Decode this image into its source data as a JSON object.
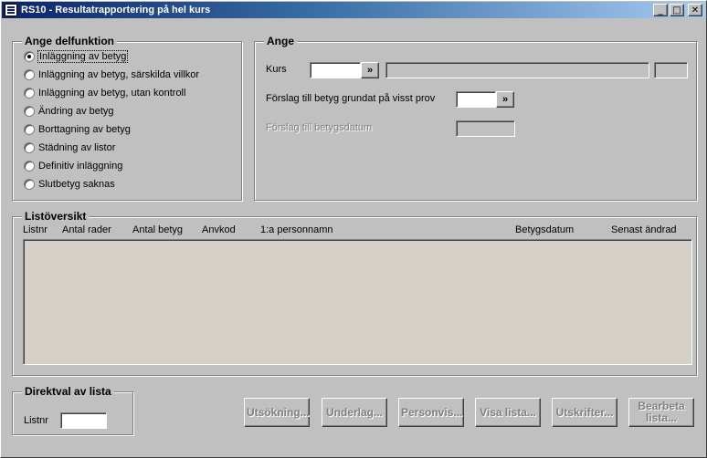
{
  "window": {
    "title": "RS10 - Resultatrapportering på hel kurs",
    "minimize": "_",
    "maximize": "□",
    "close": "✕"
  },
  "delfunktion": {
    "label": "Ange delfunktion",
    "options": [
      {
        "label": "Inläggning av betyg",
        "checked": true
      },
      {
        "label": "Inläggning av betyg, särskilda villkor",
        "checked": false
      },
      {
        "label": "Inläggning av betyg, utan kontroll",
        "checked": false
      },
      {
        "label": "Ändring av betyg",
        "checked": false
      },
      {
        "label": "Borttagning av betyg",
        "checked": false
      },
      {
        "label": "Städning av listor",
        "checked": false
      },
      {
        "label": "Definitiv inläggning",
        "checked": false
      },
      {
        "label": "Slutbetyg saknas",
        "checked": false
      }
    ]
  },
  "ange": {
    "label": "Ange",
    "kurs_label": "Kurs",
    "kurs_value": "",
    "lookup": "»",
    "forslag_prov_label": "Förslag till betyg grundat på visst prov",
    "forslag_prov_value": "",
    "forslag_datum_label": "Förslag till betygsdatum",
    "forslag_datum_value": ""
  },
  "listoversikt": {
    "label": "Listöversikt",
    "columns": [
      "Listnr",
      "Antal rader",
      "Antal betyg",
      "Anvkod",
      "1:a personnamn",
      "Betygsdatum",
      "Senast ändrad"
    ],
    "rows": []
  },
  "direktval": {
    "label": "Direktval av lista",
    "listnr_label": "Listnr",
    "listnr_value": ""
  },
  "buttons": {
    "utsokning": "Utsökning...",
    "underlag": "Underlag...",
    "personvis": "Personvis...",
    "visa_lista": "Visa lista...",
    "utskrifter": "Utskrifter...",
    "bearbeta_line1": "Bearbeta",
    "bearbeta_line2": "lista..."
  }
}
